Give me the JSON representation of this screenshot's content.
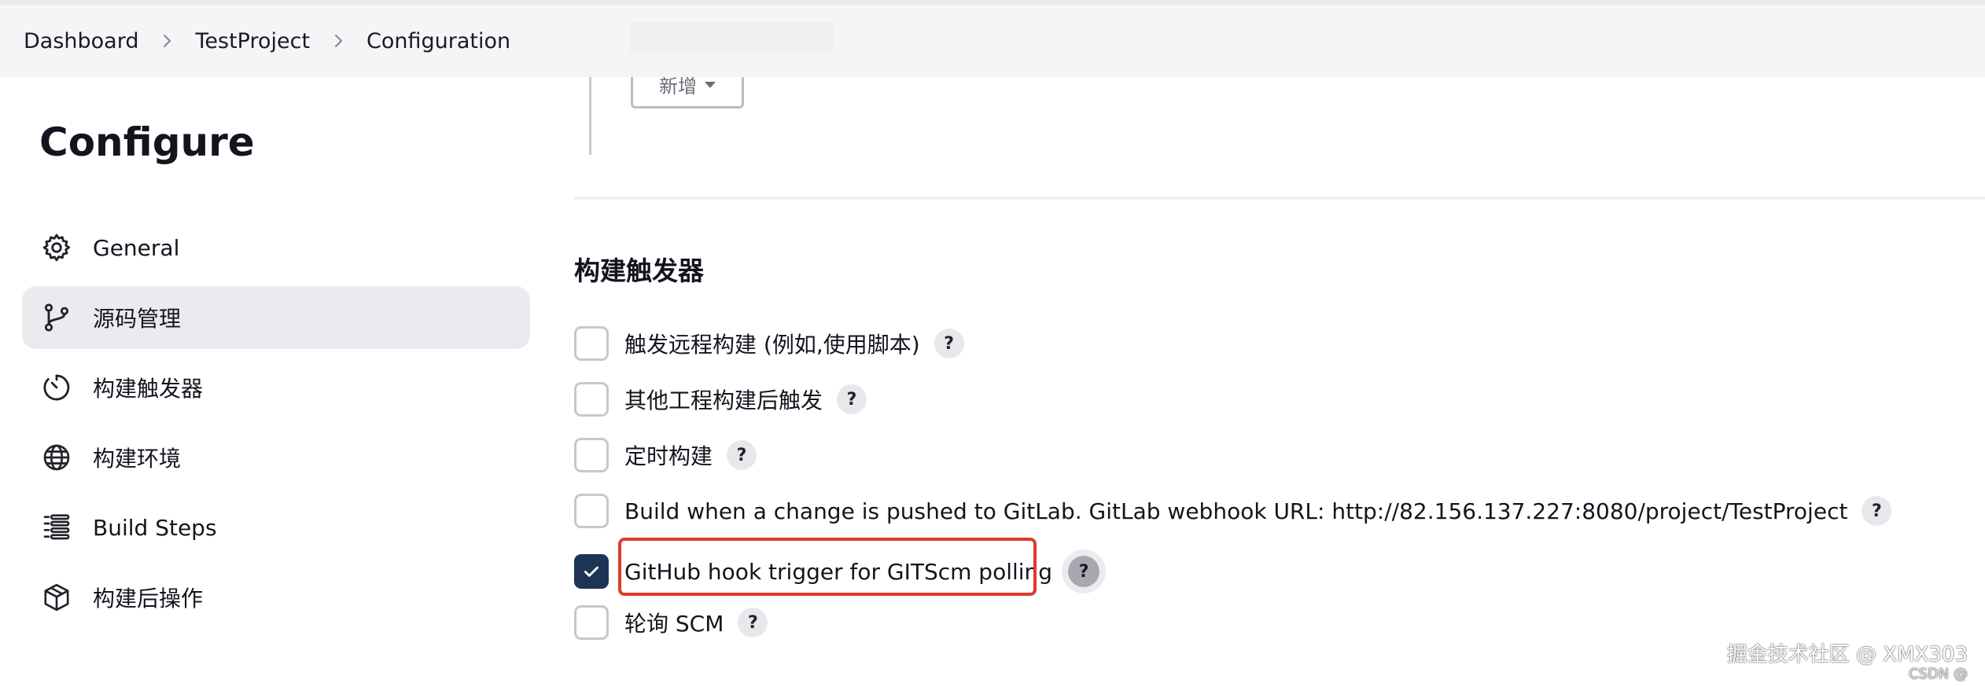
{
  "breadcrumb": {
    "items": [
      "Dashboard",
      "TestProject",
      "Configuration"
    ]
  },
  "sidebar": {
    "title": "Configure",
    "items": [
      {
        "label": "General",
        "icon": "gear-icon"
      },
      {
        "label": "源码管理",
        "icon": "branch-icon",
        "active": true
      },
      {
        "label": "构建触发器",
        "icon": "timer-icon"
      },
      {
        "label": "构建环境",
        "icon": "globe-icon"
      },
      {
        "label": "Build Steps",
        "icon": "list-icon"
      },
      {
        "label": "构建后操作",
        "icon": "package-icon"
      }
    ]
  },
  "main": {
    "add_button_label": "新增",
    "section_title": "构建触发器",
    "help_symbol": "?",
    "triggers": [
      {
        "label": "触发远程构建 (例如,使用脚本)",
        "checked": false
      },
      {
        "label": "其他工程构建后触发",
        "checked": false
      },
      {
        "label": "定时构建",
        "checked": false
      },
      {
        "label": "Build when a change is pushed to GitLab. GitLab webhook URL: http://82.156.137.227:8080/project/TestProject",
        "checked": false
      },
      {
        "label": "GitHub hook trigger for GITScm polling",
        "checked": true
      },
      {
        "label": "轮询 SCM",
        "checked": false
      }
    ]
  },
  "watermark": {
    "text": "掘金技术社区 @ XMX303",
    "sub": "CSDN @"
  },
  "colors": {
    "accent": "#1c3557",
    "highlight": "#e03a2c",
    "active_nav_bg": "#ebebef"
  }
}
